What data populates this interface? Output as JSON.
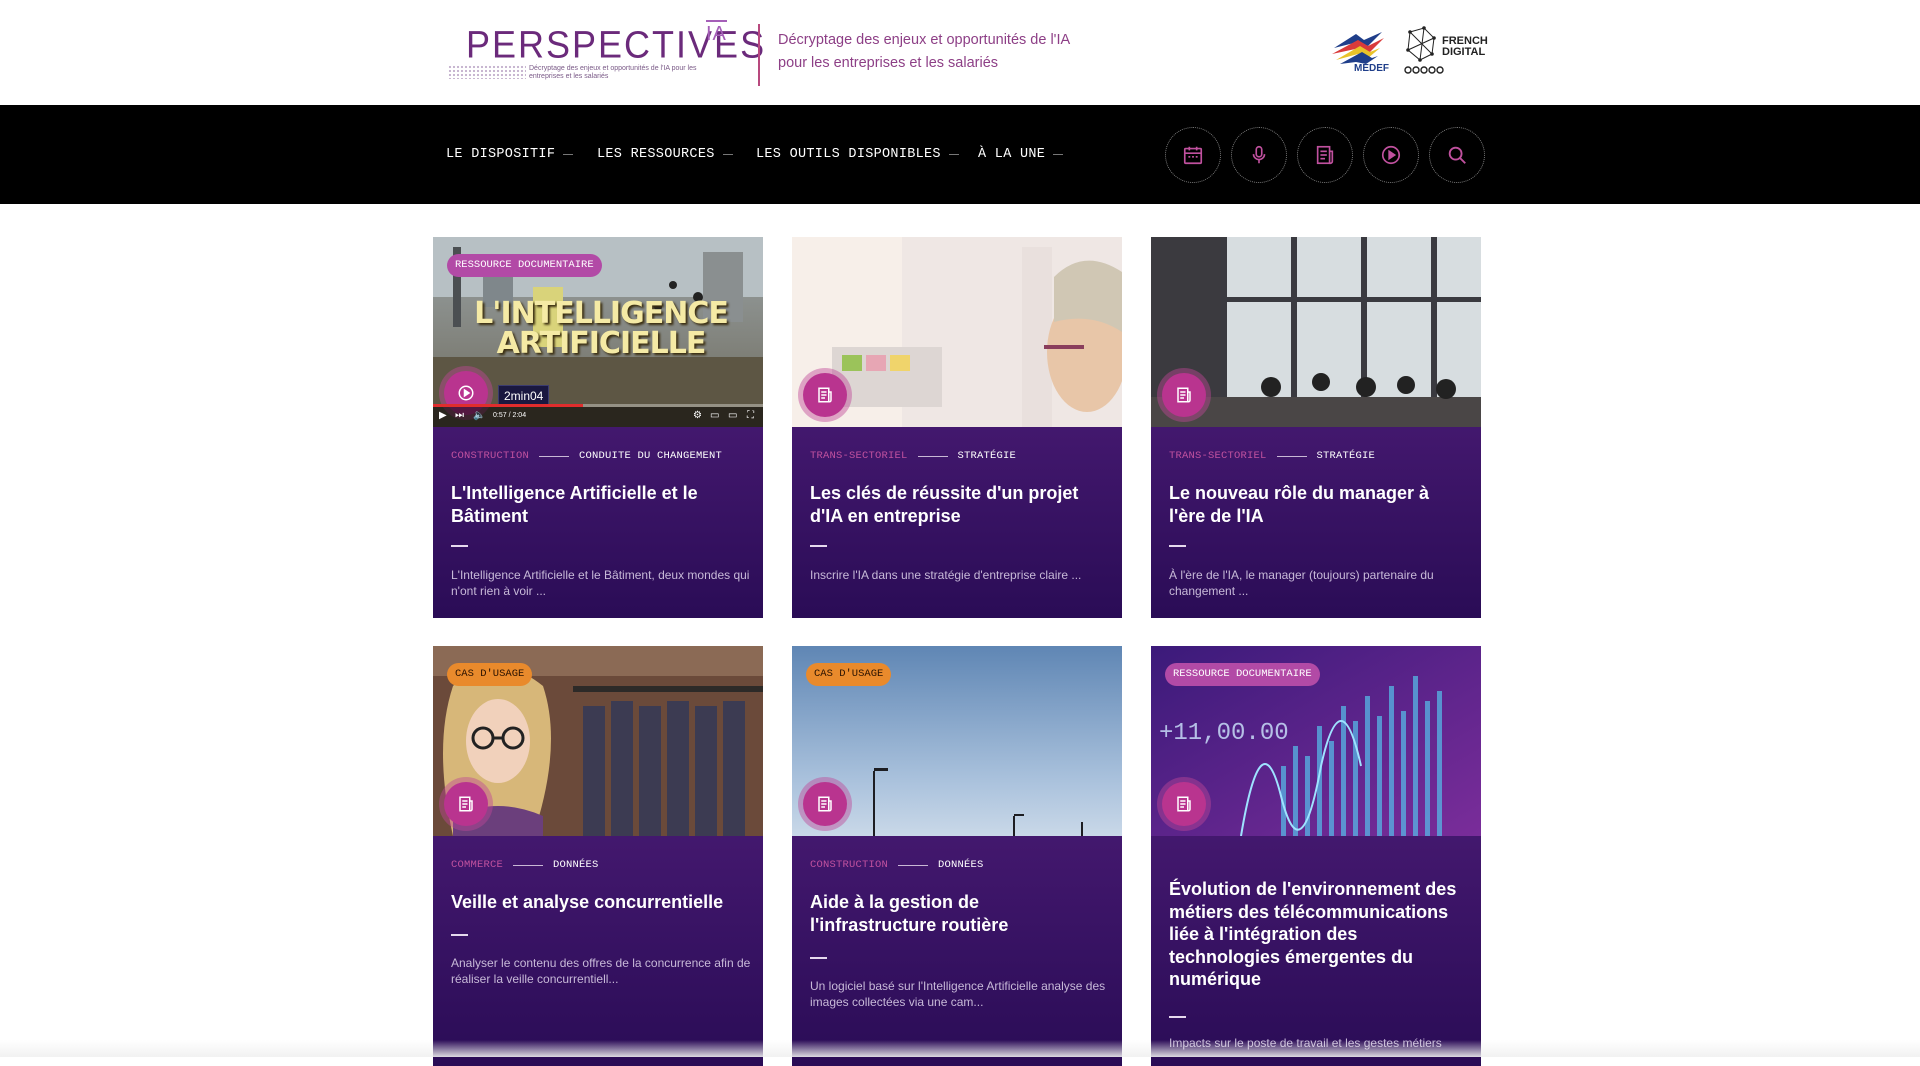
{
  "header": {
    "logo_word": "PERSPECTIVES",
    "logo_ia": "IA",
    "logo_sub": "Décryptage des enjeux et opportunités de l'IA pour les entreprises et les salariés",
    "tagline_line1": "Décryptage des enjeux et opportunités de l'IA",
    "tagline_line2": "pour les entreprises et les salariés",
    "partner1": "MEDEF",
    "partner2_line1": "FRENCH",
    "partner2_line2": "DIGITAL",
    "partner2_sub": "SKILLS & JOBS COALITION"
  },
  "nav": {
    "items": [
      {
        "label": "LE DISPOSITIF"
      },
      {
        "label": "LES RESSOURCES"
      },
      {
        "label": "LES OUTILS DISPONIBLES"
      },
      {
        "label": "À LA UNE"
      }
    ],
    "icons": [
      "calendar-icon",
      "microphone-icon",
      "document-icon",
      "play-icon",
      "search-icon"
    ],
    "accent": "#c1519f"
  },
  "cards": [
    {
      "badge": "RESSOURCE DOCUMENTAIRE",
      "badge_type": "doc",
      "image_text": "L'INTELLIGENCE ARTIFICIELLE",
      "video_time": "2min04",
      "player_time": "0:57 / 2:04",
      "tag1": "CONSTRUCTION",
      "tag2": "CONDUITE DU CHANGEMENT",
      "title": "L'Intelligence Artificielle et le Bâtiment",
      "desc": "L'Intelligence Artificielle et le Bâtiment, deux mondes qui n'ont rien à voir ...",
      "icon": "play-icon"
    },
    {
      "tag1": "TRANS-SECTORIEL",
      "tag2": "STRATÉGIE",
      "title": "Les clés de réussite d'un projet d'IA en entreprise",
      "desc": "Inscrire l'IA dans une stratégie d'entreprise claire ...",
      "icon": "document-icon"
    },
    {
      "tag1": "TRANS-SECTORIEL",
      "tag2": "STRATÉGIE",
      "title": "Le nouveau rôle du manager à l'ère de l'IA",
      "desc": "À l'ère de l'IA, le manager (toujours) partenaire du changement ...",
      "icon": "document-icon"
    },
    {
      "badge": "CAS D'USAGE",
      "badge_type": "cas",
      "tag1": "COMMERCE",
      "tag2": "DONNÉES",
      "title": "Veille et analyse concurrentielle",
      "desc": "Analyser le contenu des offres de la concurrence afin de réaliser la veille concurrentiell...",
      "icon": "document-icon"
    },
    {
      "badge": "CAS D'USAGE",
      "badge_type": "cas",
      "tag1": "CONSTRUCTION",
      "tag2": "DONNÉES",
      "title": "Aide à la gestion de l'infrastructure routière",
      "desc": "Un logiciel basé sur l'Intelligence Artificielle analyse des images collectées via une cam...",
      "icon": "document-icon"
    },
    {
      "badge": "RESSOURCE DOCUMENTAIRE",
      "badge_type": "doc",
      "image_text": "+11,00.00",
      "title": "Évolution de l'environnement des métiers des télécommunications liée à l'intégration des technologies émergentes du numérique",
      "desc": "Impacts sur le poste de travail et les gestes métiers",
      "icon": "document-icon"
    }
  ]
}
